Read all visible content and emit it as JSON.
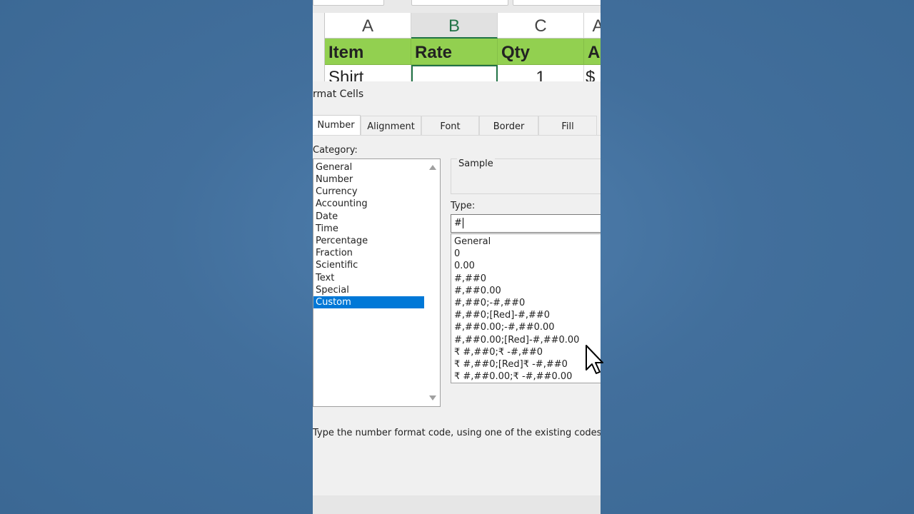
{
  "spreadsheet": {
    "columns": [
      "A",
      "B",
      "C",
      "A"
    ],
    "selected_column": "B",
    "header_row": [
      "Item",
      "Rate",
      "Qty",
      "A"
    ],
    "data_row": [
      "Shirt",
      "",
      "1",
      "$"
    ]
  },
  "dialog": {
    "title": "rmat Cells",
    "tabs": [
      "Number",
      "Alignment",
      "Font",
      "Border",
      "Fill"
    ],
    "active_tab": "Number",
    "category_label": "Category:",
    "categories": [
      "General",
      "Number",
      "Currency",
      "Accounting",
      "Date",
      "Time",
      "Percentage",
      "Fraction",
      "Scientific",
      "Text",
      "Special",
      "Custom"
    ],
    "selected_category": "Custom",
    "sample_label": "Sample",
    "type_label": "Type:",
    "type_value": "#",
    "type_options": [
      "General",
      "0",
      "0.00",
      "#,##0",
      "#,##0.00",
      "#,##0;-#,##0",
      "#,##0;[Red]-#,##0",
      "#,##0.00;-#,##0.00",
      "#,##0.00;[Red]-#,##0.00",
      "₹ #,##0;₹ -#,##0",
      "₹ #,##0;[Red]₹ -#,##0",
      "₹ #,##0.00;₹ -#,##0.00"
    ],
    "description": "Type the number format code, using one of the existing codes as a s"
  },
  "colors": {
    "header_fill": "#92d050",
    "selection": "#0078d7",
    "excel_green": "#217346",
    "background": "#426f9c"
  },
  "icons": [
    "scroll-up-arrow-icon",
    "scroll-down-arrow-icon",
    "mouse-pointer-icon"
  ]
}
